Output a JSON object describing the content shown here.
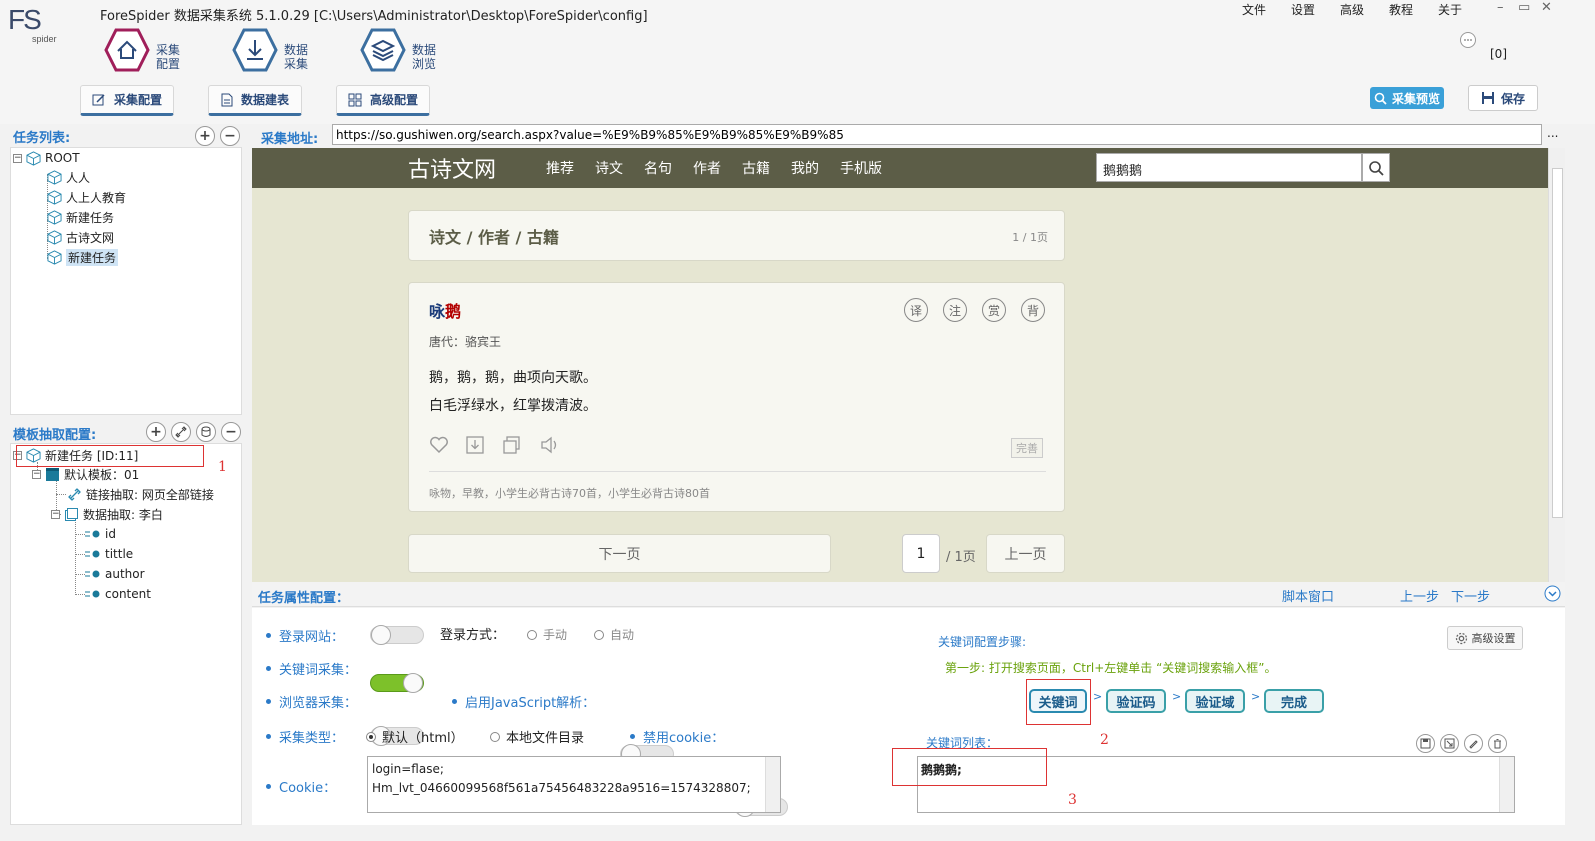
{
  "app": {
    "title": "ForeSpider 数据采集系统  5.1.0.29  [C:\\Users\\Administrator\\Desktop\\ForeSpider\\config]",
    "logo_main": "FS",
    "logo_sub": "spider",
    "notify_count": "[0]"
  },
  "menu": [
    "文件",
    "设置",
    "高级",
    "教程",
    "关于"
  ],
  "window_controls": [
    "–",
    "▭",
    "✕"
  ],
  "main_tabs": [
    {
      "line1": "采集",
      "line2": "配置"
    },
    {
      "line1": "数据",
      "line2": "采集"
    },
    {
      "line1": "数据",
      "line2": "浏览"
    }
  ],
  "sub_tabs": [
    "采集配置",
    "数据建表",
    "高级配置"
  ],
  "toolbar": {
    "preview": "采集预览",
    "save": "保存"
  },
  "task_list": {
    "label": "任务列表:",
    "root": "ROOT",
    "items": [
      "人人",
      "人上人教育",
      "新建任务",
      "古诗文网",
      "新建任务"
    ]
  },
  "url_bar": {
    "label": "采集地址:",
    "value": "https://so.gushiwen.org/search.aspx?value=%E9%B9%85%E9%B9%85%E9%B9%85",
    "more": "..."
  },
  "template": {
    "label": "模板抽取配置:",
    "task": "新建任务 [ID:11]",
    "default_tpl": "默认模板：01",
    "link_extract": "链接抽取: 网页全部链接",
    "data_extract": "数据抽取: 李白",
    "fields": [
      "id",
      "tittle",
      "author",
      "content"
    ]
  },
  "site": {
    "logo": "古诗文网",
    "nav": [
      "推荐",
      "诗文",
      "名句",
      "作者",
      "古籍",
      "我的",
      "手机版"
    ],
    "search_value": "鹅鹅鹅",
    "breadcrumb": "诗文 / 作者 / 古籍",
    "page_count": "1 / 1页",
    "poem": {
      "title_pre": "咏",
      "title_hl": "鹅",
      "tools": [
        "译",
        "注",
        "赏",
        "背"
      ],
      "dynasty": "唐代：",
      "author": "骆宾王",
      "lines": [
        "鹅，鹅，鹅，曲项向天歌。",
        "白毛浮绿水，红掌拨清波。"
      ],
      "badge": "完善",
      "tags": "咏物，早教，小学生必背古诗70首，小学生必背古诗80首"
    },
    "pager": {
      "next": "下一页",
      "current": "1",
      "total": "/ 1页",
      "prev": "上一页"
    }
  },
  "props": {
    "label": "任务属性配置：",
    "script_window": "脚本窗口",
    "prev_step": "上一步",
    "next_step": "下一步",
    "login_site": "登录网站：",
    "login_mode": "登录方式：",
    "login_manual": "手动",
    "login_auto": "自动",
    "keyword_collect": "关键词采集：",
    "browser_collect": "浏览器采集：",
    "js_parse": "启用JavaScript解析：",
    "collect_type": "采集类型：",
    "type_default": "默认（html）",
    "type_local": "本地文件目录",
    "disable_cookie": "禁用cookie：",
    "cookie_label": "Cookie：",
    "cookie_lines": [
      "login=flase;",
      "Hm_lvt_04660099568f561a75456483228a9516=1574328807;"
    ],
    "kw_steps_title": "关键词配置步骤:",
    "advanced": "高级设置",
    "step1": "第一步: 打开搜索页面，Ctrl+左键单击 “关键词搜索输入框”。",
    "steps": [
      "关键词",
      "验证码",
      "验证域",
      "完成"
    ],
    "kw_list_label": "关键词列表：",
    "kw_value": "鹅鹅鹅;"
  },
  "annotations": [
    "1",
    "2",
    "3"
  ],
  "colors": {
    "accent": "#2b7ac8",
    "site_header": "#5c5d47",
    "site_bg": "#e6e6d2",
    "toggle_on": "#7dc12a",
    "annotation": "#dd3333"
  }
}
